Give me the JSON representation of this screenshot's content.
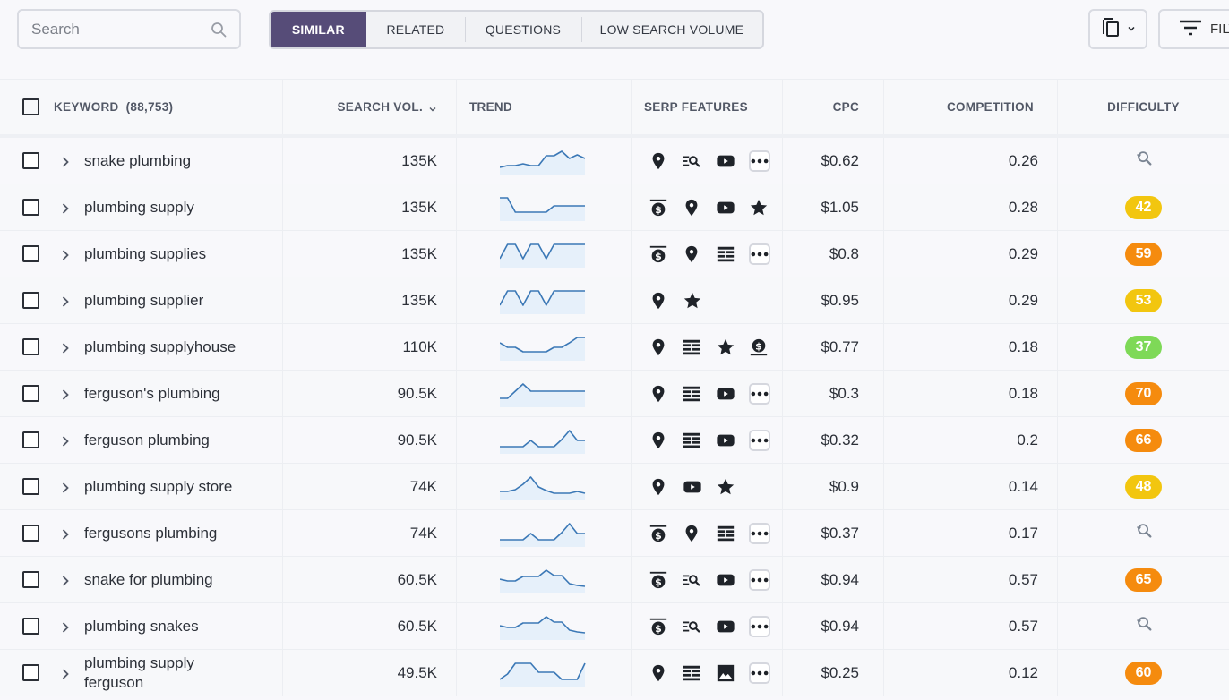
{
  "search": {
    "placeholder": "Search",
    "value": ""
  },
  "tabs": [
    {
      "label": "SIMILAR",
      "active": true
    },
    {
      "label": "RELATED",
      "active": false
    },
    {
      "label": "QUESTIONS",
      "active": false
    },
    {
      "label": "LOW SEARCH VOLUME",
      "active": false
    }
  ],
  "toolbar": {
    "copy_icon": "copy-icon",
    "filter_label": "FILTERS"
  },
  "table": {
    "headers": {
      "keyword": "KEYWORD",
      "keyword_count": "(88,753)",
      "search_vol": "SEARCH VOL.",
      "trend": "TREND",
      "serp": "SERP FEATURES",
      "cpc": "CPC",
      "competition": "COMPETITION",
      "difficulty": "DIFFICULTY"
    },
    "colors": {
      "trend_line": "#3b78b6",
      "trend_fill": "#e6f0fa",
      "diff_yellow": "#f2c60f",
      "diff_orange": "#f58b0e",
      "diff_green": "#7ed957",
      "icon": "#1f2329",
      "analyze_icon": "#7b8593"
    },
    "rows": [
      {
        "keyword": "snake plumbing",
        "volume": "135K",
        "trend": [
          0.1,
          0.2,
          0.2,
          0.3,
          0.2,
          0.2,
          0.75,
          0.75,
          1.0,
          0.6,
          0.8,
          0.6
        ],
        "serp": [
          "local-pack",
          "related-searches",
          "video",
          "more"
        ],
        "cpc": "$0.62",
        "competition": "0.26",
        "difficulty": null
      },
      {
        "keyword": "plumbing supply",
        "volume": "135K",
        "trend": [
          1.0,
          1.0,
          0.2,
          0.2,
          0.2,
          0.2,
          0.2,
          0.55,
          0.55,
          0.55,
          0.55,
          0.55
        ],
        "serp": [
          "top-ads",
          "local-pack",
          "video",
          "reviews"
        ],
        "cpc": "$1.05",
        "competition": "0.28",
        "difficulty": 42
      },
      {
        "keyword": "plumbing supplies",
        "volume": "135K",
        "trend": [
          0.2,
          1.0,
          1.0,
          0.2,
          1.0,
          1.0,
          0.2,
          1.0,
          1.0,
          1.0,
          1.0,
          1.0
        ],
        "serp": [
          "top-ads",
          "local-pack",
          "sitelinks",
          "more"
        ],
        "cpc": "$0.8",
        "competition": "0.29",
        "difficulty": 59
      },
      {
        "keyword": "plumbing supplier",
        "volume": "135K",
        "trend": [
          0.2,
          1.0,
          1.0,
          0.2,
          1.0,
          1.0,
          0.2,
          1.0,
          1.0,
          1.0,
          1.0,
          1.0
        ],
        "serp": [
          "local-pack",
          "reviews"
        ],
        "cpc": "$0.95",
        "competition": "0.29",
        "difficulty": 53
      },
      {
        "keyword": "plumbing supplyhouse",
        "volume": "110K",
        "trend": [
          0.7,
          0.45,
          0.45,
          0.2,
          0.2,
          0.2,
          0.2,
          0.45,
          0.45,
          0.7,
          1.0,
          1.0
        ],
        "serp": [
          "local-pack",
          "sitelinks",
          "reviews",
          "bottom-ads"
        ],
        "cpc": "$0.77",
        "competition": "0.18",
        "difficulty": 37
      },
      {
        "keyword": "ferguson's plumbing",
        "volume": "90.5K",
        "trend": [
          0.2,
          0.2,
          0.6,
          1.0,
          0.6,
          0.6,
          0.6,
          0.6,
          0.6,
          0.6,
          0.6,
          0.6
        ],
        "serp": [
          "local-pack",
          "sitelinks",
          "video",
          "more"
        ],
        "cpc": "$0.3",
        "competition": "0.18",
        "difficulty": 70
      },
      {
        "keyword": "ferguson plumbing",
        "volume": "90.5K",
        "trend": [
          0.1,
          0.1,
          0.1,
          0.1,
          0.45,
          0.1,
          0.1,
          0.1,
          0.5,
          1.0,
          0.45,
          0.45
        ],
        "serp": [
          "local-pack",
          "sitelinks",
          "video",
          "more"
        ],
        "cpc": "$0.32",
        "competition": "0.2",
        "difficulty": 66
      },
      {
        "keyword": "plumbing supply store",
        "volume": "74K",
        "trend": [
          0.2,
          0.2,
          0.3,
          0.6,
          1.0,
          0.45,
          0.25,
          0.1,
          0.1,
          0.1,
          0.2,
          0.1
        ],
        "serp": [
          "local-pack",
          "video",
          "reviews"
        ],
        "cpc": "$0.9",
        "competition": "0.14",
        "difficulty": 48
      },
      {
        "keyword": "fergusons plumbing",
        "volume": "74K",
        "trend": [
          0.1,
          0.1,
          0.1,
          0.1,
          0.45,
          0.1,
          0.1,
          0.1,
          0.5,
          1.0,
          0.45,
          0.45
        ],
        "serp": [
          "top-ads",
          "local-pack",
          "sitelinks",
          "more"
        ],
        "cpc": "$0.37",
        "competition": "0.17",
        "difficulty": null
      },
      {
        "keyword": "snake for plumbing",
        "volume": "60.5K",
        "trend": [
          0.5,
          0.4,
          0.4,
          0.65,
          0.65,
          0.65,
          1.0,
          0.7,
          0.7,
          0.25,
          0.15,
          0.1
        ],
        "serp": [
          "top-ads",
          "related-searches",
          "video",
          "more"
        ],
        "cpc": "$0.94",
        "competition": "0.57",
        "difficulty": 65
      },
      {
        "keyword": "plumbing snakes",
        "volume": "60.5K",
        "trend": [
          0.5,
          0.4,
          0.4,
          0.65,
          0.65,
          0.65,
          1.0,
          0.7,
          0.7,
          0.25,
          0.15,
          0.1
        ],
        "serp": [
          "top-ads",
          "related-searches",
          "video",
          "more"
        ],
        "cpc": "$0.94",
        "competition": "0.57",
        "difficulty": null
      },
      {
        "keyword": "plumbing supply ferguson",
        "volume": "49.5K",
        "trend": [
          0.1,
          0.4,
          1.0,
          1.0,
          1.0,
          0.5,
          0.5,
          0.5,
          0.1,
          0.1,
          0.1,
          1.0
        ],
        "serp": [
          "local-pack",
          "sitelinks",
          "image",
          "more"
        ],
        "cpc": "$0.25",
        "competition": "0.12",
        "difficulty": 60
      }
    ]
  }
}
